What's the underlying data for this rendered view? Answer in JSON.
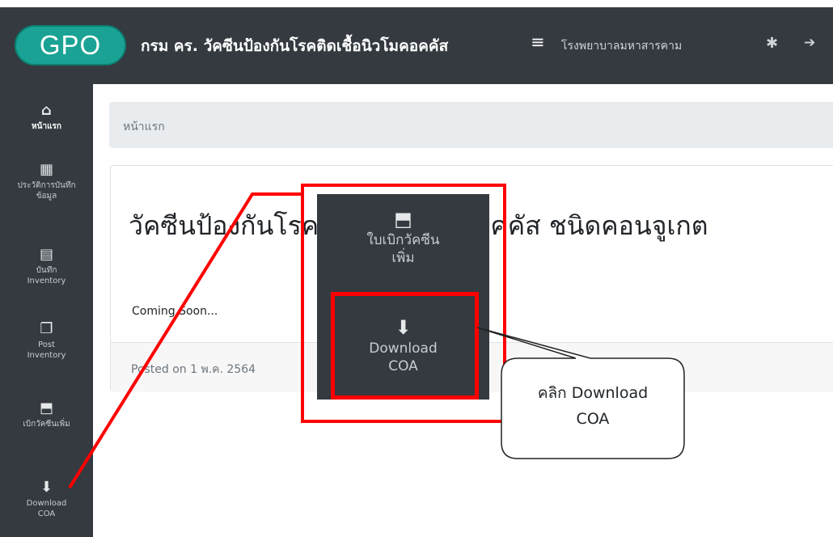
{
  "header": {
    "logo_text": "GPO",
    "title": "กรม คร. วัคซีนป้องกันโรคติดเชื้อนิวโมคอคคัส",
    "menu_icon": "≡",
    "hospital": "โรงพยาบาลมหาสารคาม"
  },
  "sidebar": {
    "items": [
      {
        "icon": "home-icon",
        "glyph": "🏠",
        "label": "หน้าแรก"
      },
      {
        "icon": "calendar-icon",
        "glyph": "▦",
        "label": "ประวัติการบันทึกข้อมูล"
      },
      {
        "icon": "clipboard-icon",
        "glyph": "▤",
        "label": "บันทึก Inventory"
      },
      {
        "icon": "copy-icon",
        "glyph": "❐",
        "label": "Post Inventory"
      },
      {
        "icon": "pdf-file-icon",
        "glyph": "⬒",
        "label": "เบิกวัคซีนเพิ่ม"
      },
      {
        "icon": "download-file-icon",
        "glyph": "⬇",
        "label": "Download COA"
      }
    ]
  },
  "breadcrumb": {
    "label": "หน้าแรก"
  },
  "card": {
    "title": "วัคซีนป้องกันโรคติดเชื้อนิวโมคอคคัส ชนิดคอนจูเกต",
    "body": "Coming Soon...",
    "footer": "Posted on 1 พ.ค. 2564"
  },
  "zoom": {
    "items": [
      {
        "icon": "pdf-file-icon",
        "glyph": "⬒",
        "label_line1": "ใบเบิกวัคซีน",
        "label_line2": "เพิ่ม"
      },
      {
        "icon": "download-file-icon",
        "glyph": "⬇",
        "label_line1": "Download",
        "label_line2": "COA"
      }
    ]
  },
  "callout": {
    "line1": "คลิก Download",
    "line2": "COA"
  },
  "colors": {
    "dark": "#343a40",
    "brand": "#1aa394",
    "highlight": "#ff0000"
  }
}
